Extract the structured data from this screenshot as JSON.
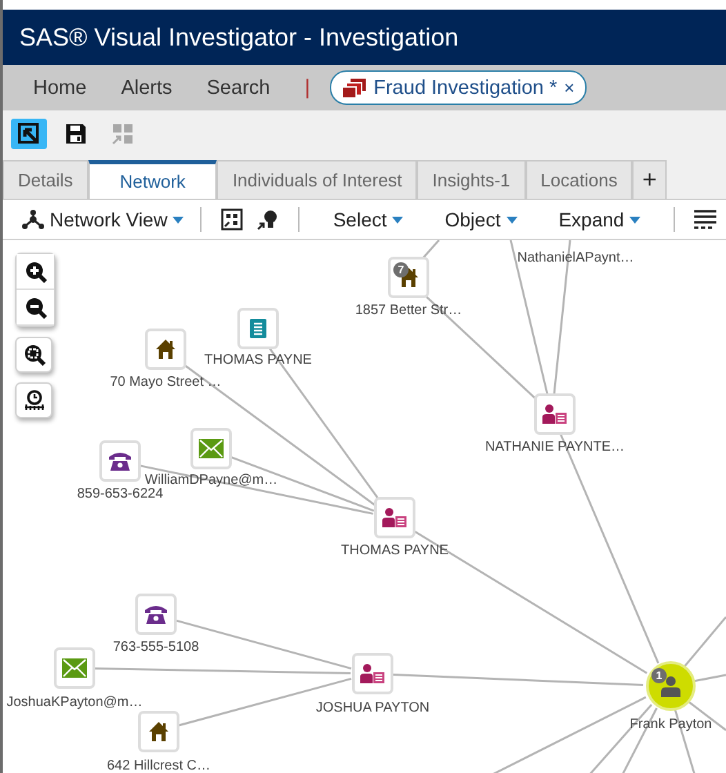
{
  "window": {
    "title": "SAS® Visual Investigator - Investigation"
  },
  "nav": {
    "items": [
      "Home",
      "Alerts",
      "Search"
    ],
    "separator": "|",
    "open_tab": {
      "label": "Fraud Investigation *",
      "close": "×"
    }
  },
  "toolbar": [
    {
      "kind": "select",
      "selected": true,
      "disabled": false
    },
    {
      "kind": "save",
      "selected": false,
      "disabled": false
    },
    {
      "kind": "layout",
      "selected": false,
      "disabled": true
    }
  ],
  "tabs": [
    {
      "label": "Details",
      "selected": false
    },
    {
      "label": "Network",
      "selected": true
    },
    {
      "label": "Individuals of Interest",
      "selected": false
    },
    {
      "label": "Insights-1",
      "selected": false
    },
    {
      "label": "Locations",
      "selected": false
    }
  ],
  "add_tab": "+",
  "network_toolbar": {
    "view_menu": "Network View",
    "menus": [
      "Select",
      "Object",
      "Expand"
    ]
  },
  "nodes": [
    {
      "kind": "house",
      "label": "1857 Better Str…",
      "badge": "7"
    },
    {
      "kind": "label_only",
      "label": "NathanielAPaynt…"
    },
    {
      "kind": "notes",
      "label": "THOMAS PAYNE"
    },
    {
      "kind": "house",
      "label": "70 Mayo Street …"
    },
    {
      "kind": "card",
      "label": "NATHANIE PAYNTE…"
    },
    {
      "kind": "email",
      "label": "WilliamDPayne@m…"
    },
    {
      "kind": "phone",
      "label": "859-653-6224"
    },
    {
      "kind": "card",
      "label": "THOMAS PAYNE"
    },
    {
      "kind": "phone",
      "label": "763-555-5108"
    },
    {
      "kind": "email",
      "label": "JoshuaKPayton@m…"
    },
    {
      "kind": "card",
      "label": "JOSHUA PAYTON"
    },
    {
      "kind": "house",
      "label": "642 Hillcrest C…"
    },
    {
      "kind": "root",
      "label": "Frank Payton",
      "badge": "1"
    }
  ]
}
